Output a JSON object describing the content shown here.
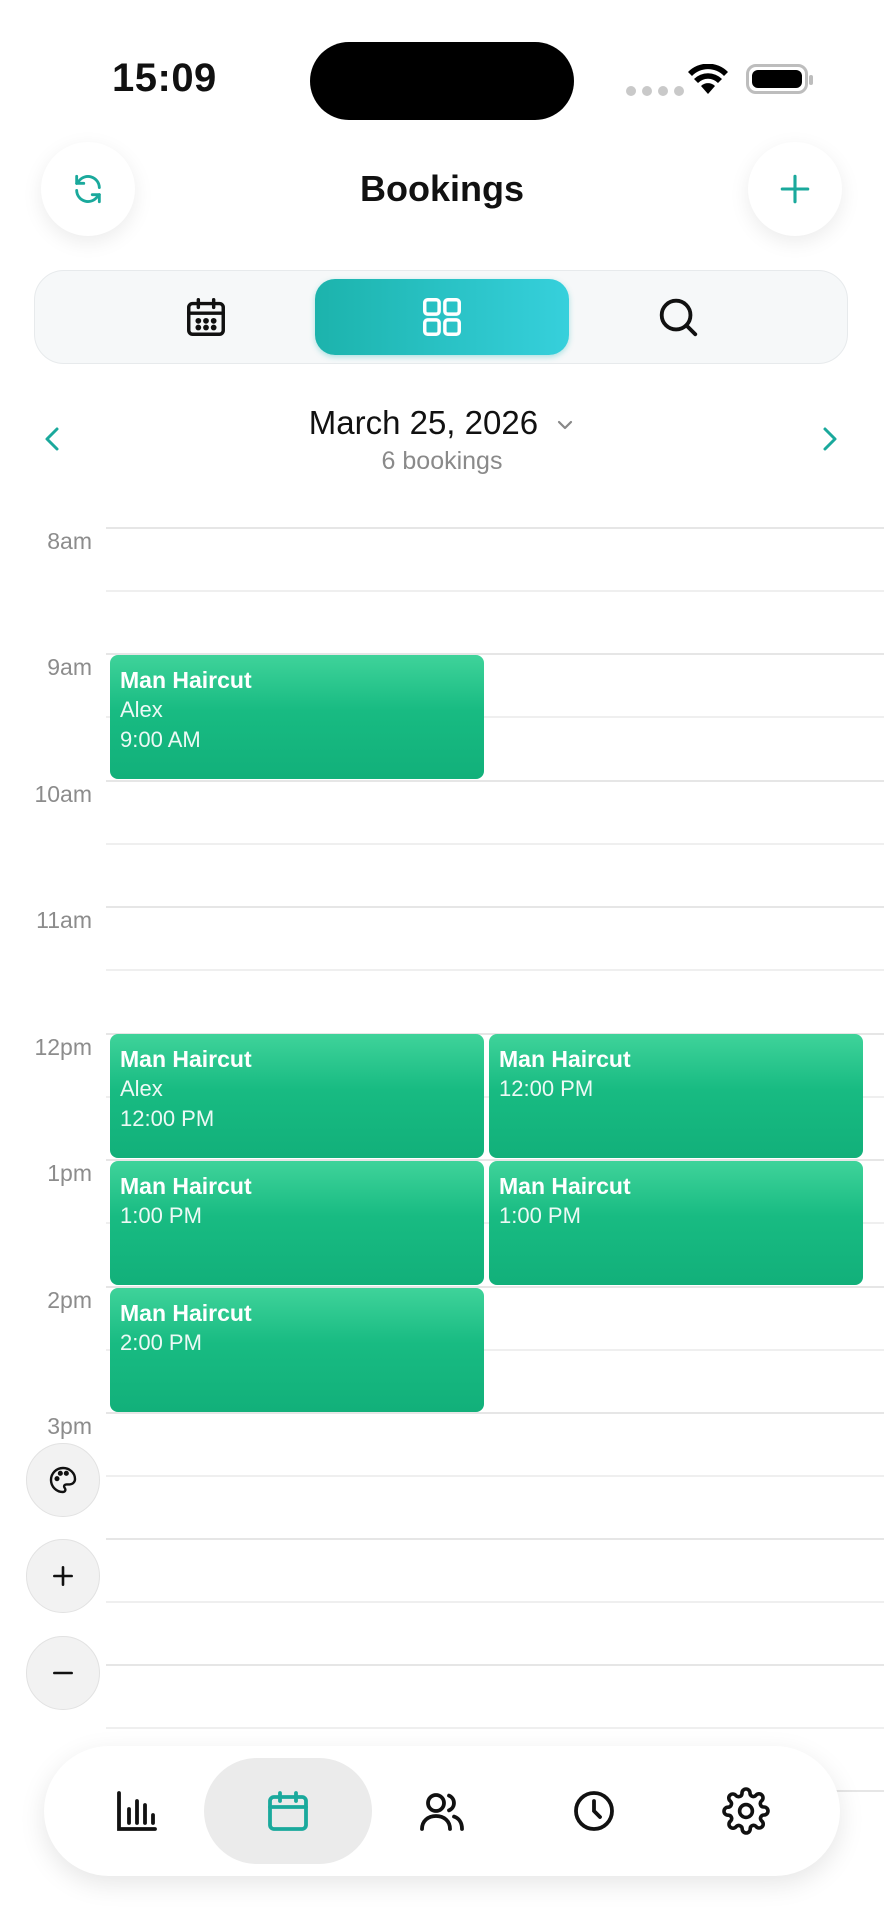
{
  "status_bar": {
    "time": "15:09"
  },
  "header": {
    "title": "Bookings"
  },
  "date_nav": {
    "date": "March 25, 2026",
    "count": "6 bookings"
  },
  "hours": [
    "8am",
    "9am",
    "10am",
    "11am",
    "12pm",
    "1pm",
    "2pm",
    "3pm"
  ],
  "events": [
    {
      "title": "Man Haircut",
      "client": "Alex",
      "time": "9:00 AM"
    },
    {
      "title": "Man Haircut",
      "client": "Alex",
      "time": "12:00 PM"
    },
    {
      "title": "Man Haircut",
      "time": "12:00 PM"
    },
    {
      "title": "Man Haircut",
      "time": "1:00 PM"
    },
    {
      "title": "Man Haircut",
      "time": "1:00 PM"
    },
    {
      "title": "Man Haircut",
      "time": "2:00 PM"
    }
  ],
  "colors": {
    "accent": "#1aa99c",
    "event_green": "#18bb82"
  }
}
